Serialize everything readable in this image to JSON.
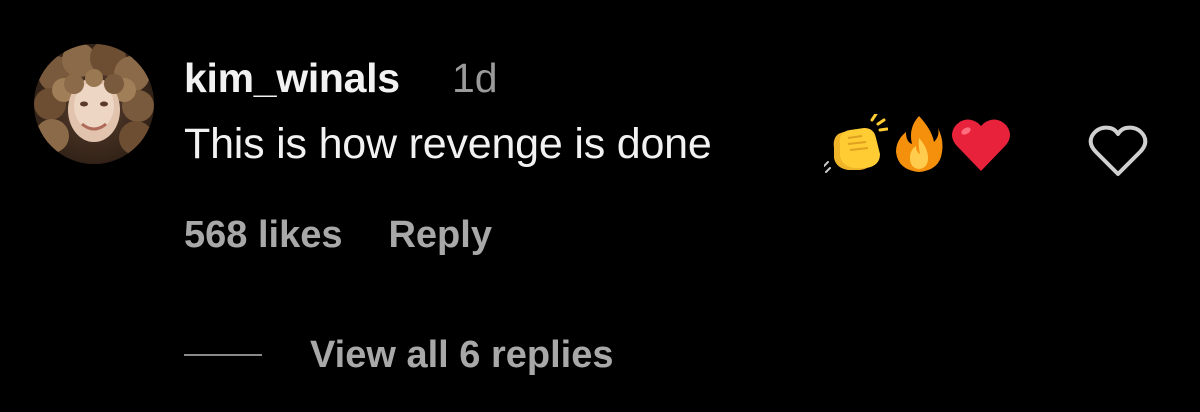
{
  "comment": {
    "username": "kim_winals",
    "timestamp": "1d",
    "text": "This is how revenge is done",
    "emojis": [
      "clapping-hands",
      "fire",
      "red-heart"
    ],
    "likes_label": "568 likes",
    "reply_label": "Reply",
    "view_replies_label": "View all 6 replies"
  },
  "colors": {
    "background": "#000000",
    "primary_text": "#f2f2f2",
    "secondary_text": "#a8a8a8",
    "timestamp": "#9a9a9a",
    "heart_outline": "#d0d0d0",
    "red_heart": "#e8223a",
    "fire": "#f4900c",
    "clap": "#ffcc33"
  },
  "icons": {
    "like": "heart-outline-icon",
    "avatar": "profile-photo"
  }
}
